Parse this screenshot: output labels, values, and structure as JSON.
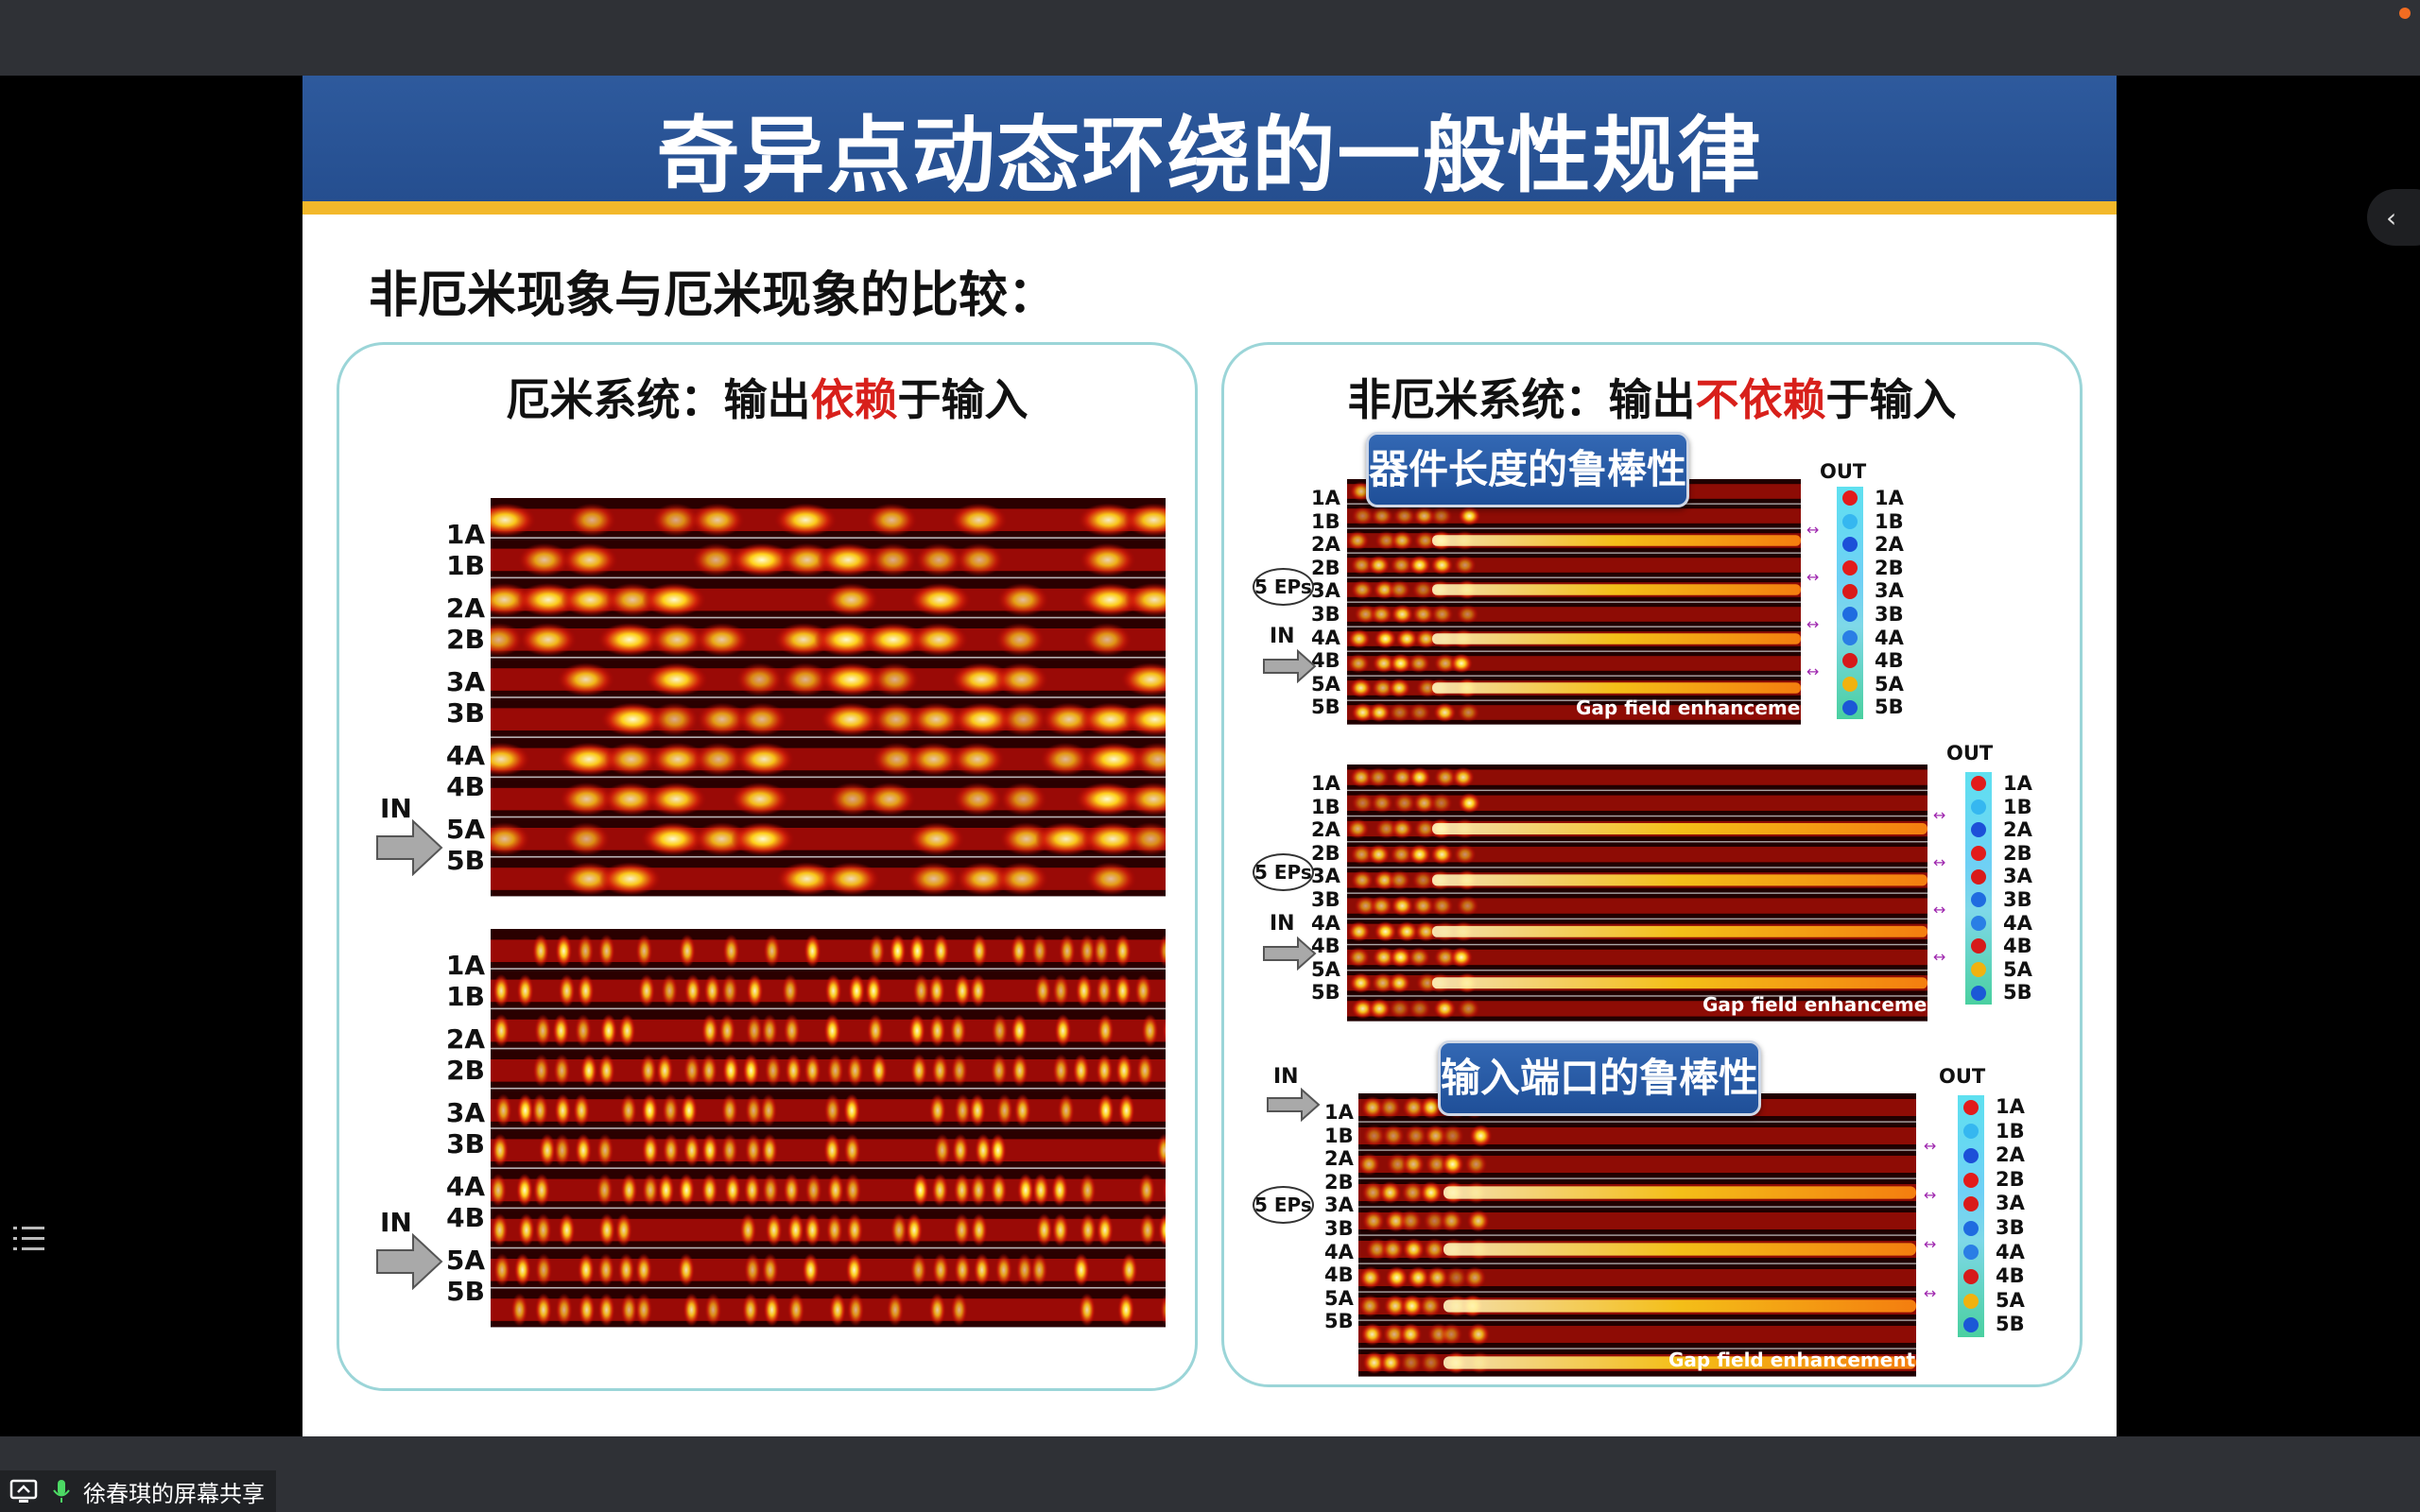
{
  "slide": {
    "title": "奇异点动态环绕的一般性规律",
    "subtitle": "非厄米现象与厄米现象的比较：",
    "left_panel": {
      "heading_prefix": "厄米系统：输出",
      "heading_highlight": "依赖",
      "heading_suffix": "于输入"
    },
    "right_panel": {
      "heading_prefix": "非厄米系统：输出",
      "heading_highlight": "不依赖",
      "heading_suffix": "于输入",
      "badge_length": "器件长度的鲁棒性",
      "badge_port": "输入端口的鲁棒性",
      "eps_label": "5 EPs",
      "gap_label": "Gap field enhancement",
      "out_label": "OUT"
    },
    "in_label": "IN",
    "rows": [
      "1A",
      "1B",
      "2A",
      "2B",
      "3A",
      "3B",
      "4A",
      "4B",
      "5A",
      "5B"
    ],
    "highlight_color": "#d8201b",
    "title_bg": "#2a5496",
    "gold_stripe": "#f3b82b"
  },
  "screen_share": {
    "label": "徐春琪的屏幕共享"
  },
  "icons": [
    "screen-share-icon",
    "microphone-icon",
    "chevron-left-icon",
    "list-icon"
  ]
}
